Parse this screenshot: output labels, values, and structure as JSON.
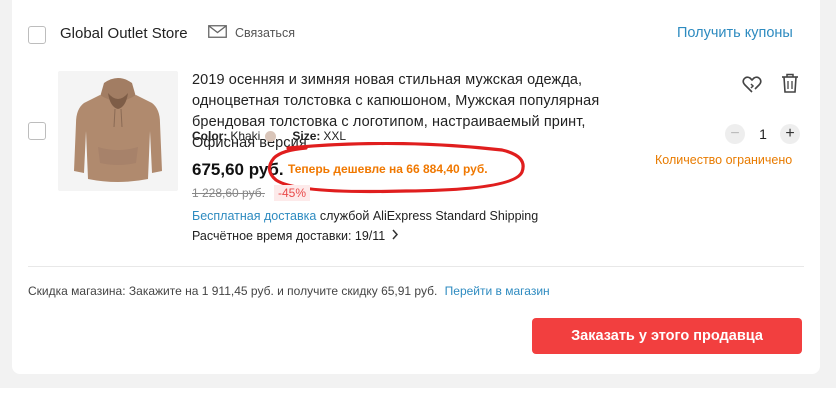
{
  "store": {
    "name": "Global Outlet Store",
    "contact_label": "Связаться",
    "coupons_label": "Получить купоны"
  },
  "item": {
    "title": "2019 осенняя и зимняя новая стильная мужская одежда, одноцветная толстовка с капюшоном, Мужская популярная брендовая толстовка с логотипом, настраиваемый принт, Офисная версия",
    "color_label": "Color:",
    "color_value": "Khaki",
    "size_label": "Size:",
    "size_value": "XXL",
    "price": "675,60 руб.",
    "promo_text": "Теперь дешевле на 66 884,40 руб.",
    "old_price": "1 228,60 руб.",
    "discount": "-45%",
    "shipping_free": "Бесплатная доставка",
    "shipping_service": "службой AliExpress Standard Shipping",
    "delivery_label": "Расчётное время доставки: 19/11",
    "quantity": "1",
    "limited_label": "Количество ограничено"
  },
  "store_discount": {
    "label": "Скидка магазина:",
    "text": "Закажите на 1 911,45 руб. и получите скидку 65,91 руб.",
    "link": "Перейти в магазин"
  },
  "order_button_label": "Заказать у этого продавца",
  "colors": {
    "accent_blue": "#2e8bc0",
    "order_red": "#f23f3f",
    "promo_orange": "#f07800",
    "annotation_red": "#e01e1e",
    "hoodie_khaki": "#b08a6e"
  },
  "icons": {
    "contact": "envelope-icon",
    "wishlist": "heart-sync-icon",
    "delete": "trash-icon",
    "delivery_more": "chevron-right-icon"
  }
}
